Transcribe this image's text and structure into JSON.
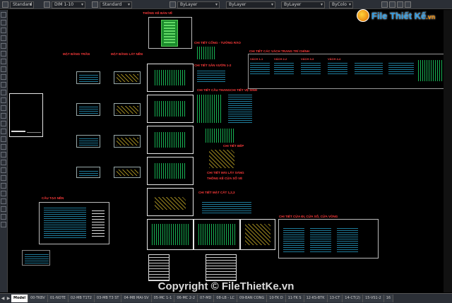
{
  "toolbar": {
    "fields": [
      "Standard",
      "DIM 1-10",
      "Standard",
      "ByLayer",
      "ByLayer",
      "ByLayer",
      "ByColo"
    ]
  },
  "labels": {
    "thong_ke_ban_ve": "THỐNG KÊ BẢN VẼ",
    "mat_bang_tran": "MẶT BẰNG TRẦN",
    "mat_bang_lat_nen": "MẶT BẰNG LÁT NỀN",
    "chi_tiet_cong_tuong_rao": "CHI TIẾT CỔNG - TƯỜNG RÀO",
    "chi_tiet_cac_vach_trang_tri": "CHI TIẾT CÁC VÁCH TRANG TRÍ CHÍNH",
    "chi_tiet_san_vuon": "CHI TIẾT SÂN VƯỜN 1-2",
    "chi_tiet_cau_thang": "CHI TIẾT CẦU THANG",
    "chi_tiet_ve_sinh": "CHI TIẾT VỆ SINH",
    "chi_tiet_bep": "CHI TIẾT BẾP",
    "chi_tiet_mai": "CHI TIẾT MÁI LẤY SÁNG",
    "thong_ke_cua": "THÔNG KÊ CỬA SỔ VÉ",
    "chi_tiet_mat_cat": "CHI TIẾT MẶT CẮT 1,2,3",
    "cau_tao_nen": "CẤU TẠO NỀN",
    "chi_tiet_cua": "CHI TIẾT CỬA ĐI, CỬA SỔ, CỬA VÒNG",
    "vach_1": "VÁCH 1-1",
    "vach_2": "VÁCH 2-2",
    "vach_3": "VÁCH 3-3",
    "vach_4": "VÁCH 4-4"
  },
  "watermark": {
    "logo_main": "File Thiết Kế",
    "logo_suffix": ".vn",
    "copyright": "Copyright © FileThietKe.vn"
  },
  "tabs": [
    {
      "label": "Model",
      "active": true
    },
    {
      "label": "00-TKBV",
      "active": false
    },
    {
      "label": "01-NOTE",
      "active": false
    },
    {
      "label": "02-MB T1T2",
      "active": false
    },
    {
      "label": "03-MB T3 ST",
      "active": false
    },
    {
      "label": "04-MB MAI-SV",
      "active": false
    },
    {
      "label": "05-MC 1-1",
      "active": false
    },
    {
      "label": "06-MC 2-2",
      "active": false
    },
    {
      "label": "07-MD",
      "active": false
    },
    {
      "label": "08-LB - LC",
      "active": false
    },
    {
      "label": "09-BAN CONG",
      "active": false
    },
    {
      "label": "10-TK D",
      "active": false
    },
    {
      "label": "11-TK S",
      "active": false
    },
    {
      "label": "12-KS-BTK",
      "active": false
    },
    {
      "label": "13-CT",
      "active": false
    },
    {
      "label": "14-CT(2)",
      "active": false
    },
    {
      "label": "15-VS1-2",
      "active": false
    },
    {
      "label": "16",
      "active": false
    }
  ]
}
